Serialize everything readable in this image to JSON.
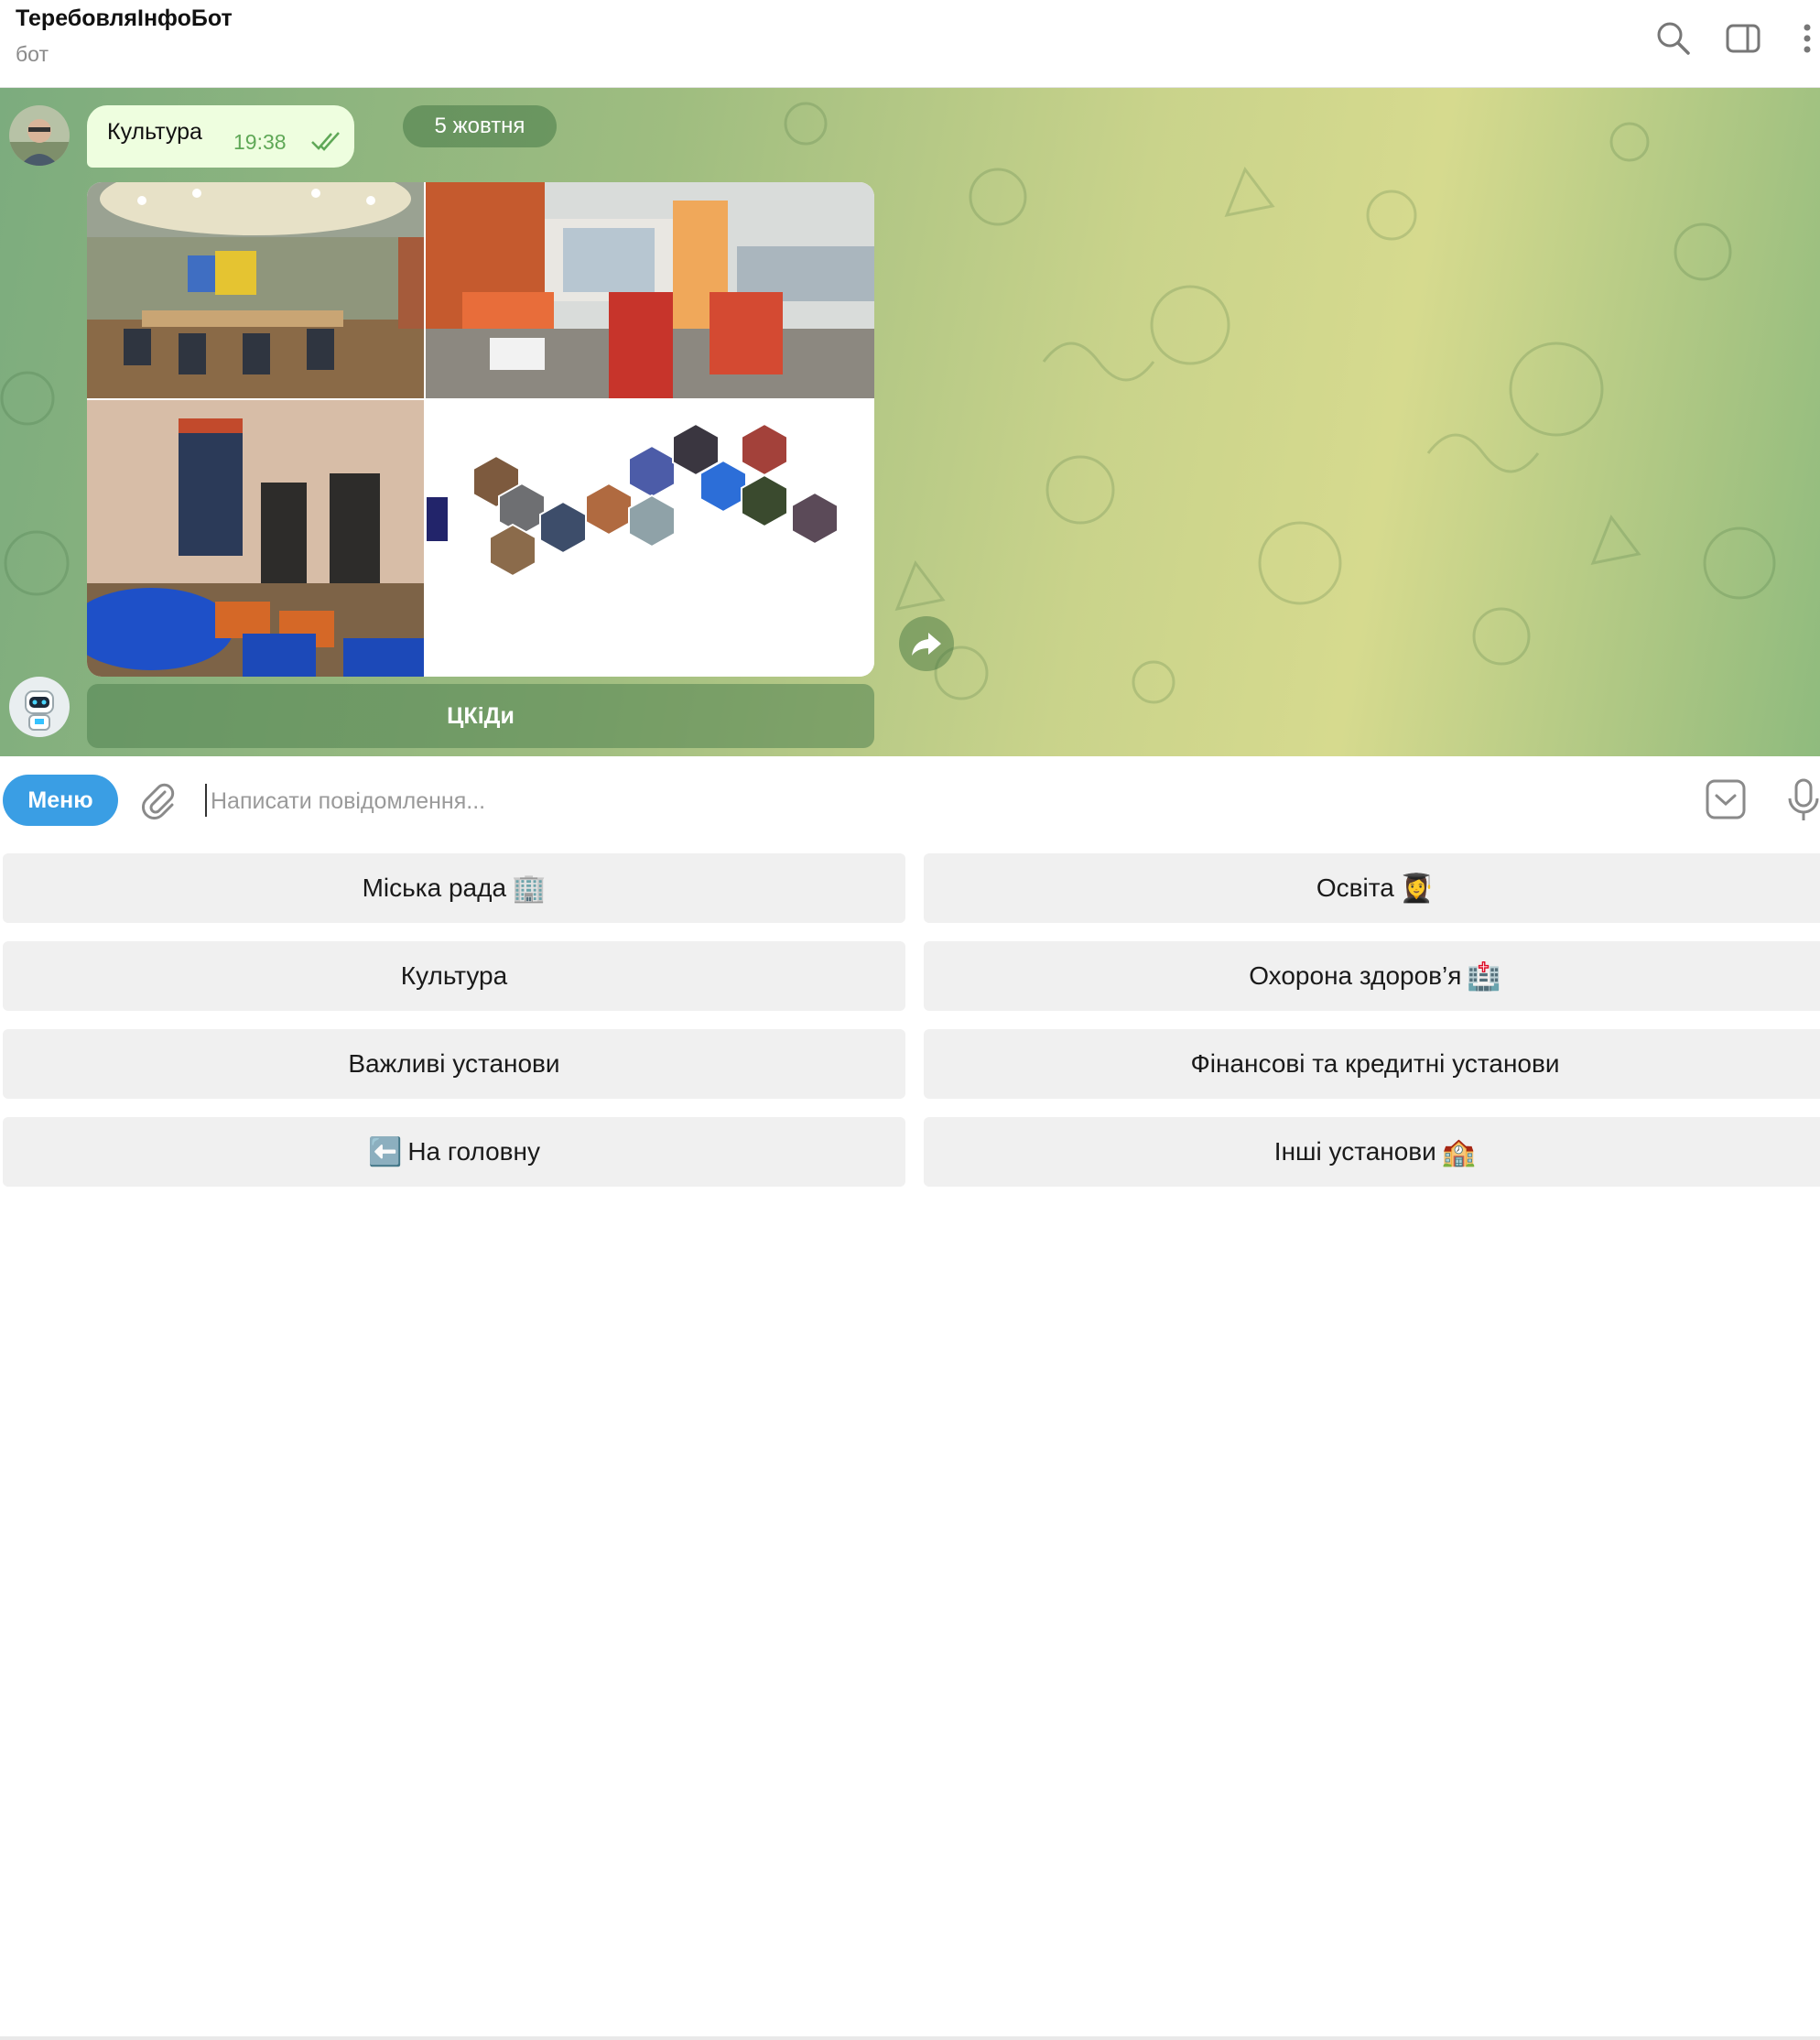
{
  "header": {
    "title": "ТеребовляІнфоБот",
    "subtitle": "бот"
  },
  "chat": {
    "date_label": "5 жовтня",
    "user_message": {
      "text": "Культура",
      "time": "19:38"
    },
    "inline_button_label": "ЦКіДи"
  },
  "composer": {
    "menu_label": "Меню",
    "placeholder": "Написати повідомлення..."
  },
  "keyboard": {
    "buttons": [
      {
        "label": "Міська рада",
        "emoji": "🏢"
      },
      {
        "label": "Освіта",
        "emoji": "👩‍🎓"
      },
      {
        "label": "Культура",
        "emoji": ""
      },
      {
        "label": "Охорона здоров’я",
        "emoji": "🏥"
      },
      {
        "label": "Важливі установи",
        "emoji": ""
      },
      {
        "label": "Фінансові та кредитні установи",
        "emoji": ""
      },
      {
        "label": "На головну",
        "emoji": "⬅️"
      },
      {
        "label": "Інші установи",
        "emoji": "🏫"
      }
    ]
  },
  "colors": {
    "accent": "#3a9ee4",
    "outgoing_bubble": "#eefedf",
    "read_check": "#5fa857"
  },
  "icons": [
    "search-icon",
    "sidebar-toggle-icon",
    "more-icon",
    "attach-icon",
    "keyboard-toggle-icon",
    "microphone-icon",
    "forward-icon",
    "double-check-icon"
  ]
}
